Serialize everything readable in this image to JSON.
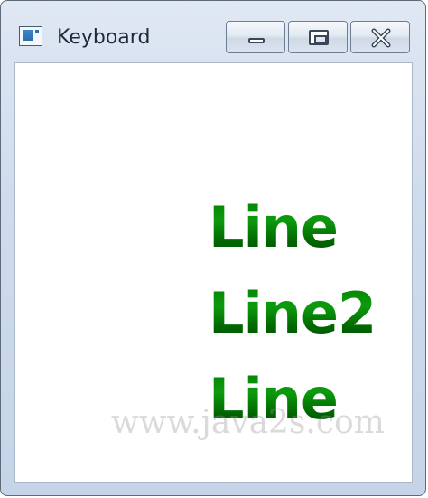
{
  "window": {
    "title": "Keyboard",
    "icon": "app-window-icon"
  },
  "caption_buttons": {
    "minimize_icon": "minimize-icon",
    "maximize_icon": "maximize-icon",
    "close_icon": "close-icon"
  },
  "content": {
    "lines": [
      "Line",
      "Line2",
      "Line"
    ],
    "text_color": "#008000",
    "watermark": "www.java2s.com"
  }
}
